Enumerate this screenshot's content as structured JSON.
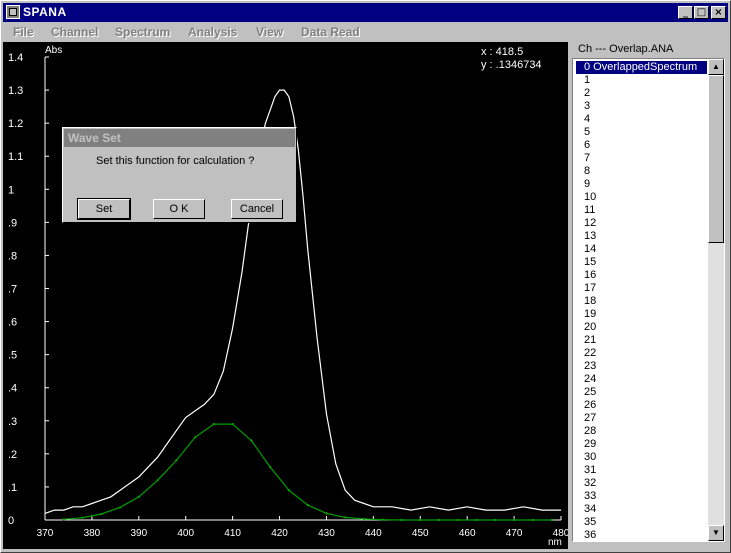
{
  "app": {
    "title": "SPANA"
  },
  "window_controls": {
    "minimize": "_",
    "maximize": "□",
    "close": "×"
  },
  "menu": [
    "File",
    "Channel",
    "Spectrum",
    "Analysis",
    "View",
    "Data Read"
  ],
  "cursor": {
    "x_readout": "x : 418.5",
    "y_readout": "y : .1346734"
  },
  "channel_list": {
    "title": "Ch --- Overlap.ANA",
    "items": [
      "0 OverlappedSpectrum",
      "1",
      "2",
      "3",
      "4",
      "5",
      "6",
      "7",
      "8",
      "9",
      "10",
      "11",
      "12",
      "13",
      "14",
      "15",
      "16",
      "17",
      "18",
      "19",
      "20",
      "21",
      "22",
      "23",
      "24",
      "25",
      "26",
      "27",
      "28",
      "29",
      "30",
      "31",
      "32",
      "33",
      "34",
      "35",
      "36"
    ],
    "selected_index": 0
  },
  "dialog": {
    "title": "Wave Set",
    "message": "Set this function for calculation ?",
    "buttons": [
      "Set",
      "O K",
      "Cancel"
    ]
  },
  "chart_data": {
    "type": "line",
    "ylabel": "Abs",
    "xlabel": "nm",
    "xlim": [
      370,
      480
    ],
    "ylim": [
      0,
      1.4
    ],
    "x_ticks": [
      "370",
      "380",
      "390",
      "400",
      "410",
      "420",
      "430",
      "440",
      "450",
      "460",
      "470",
      "480"
    ],
    "y_ticks": [
      "0",
      ".1",
      ".2",
      ".3",
      ".4",
      ".5",
      ".6",
      ".7",
      ".8",
      ".9",
      "1",
      "1.1",
      "1.2",
      "1.3",
      "1.4"
    ],
    "series": [
      {
        "color": "#ffffff",
        "x": [
          370,
          372,
          374,
          376,
          378,
          380,
          382,
          384,
          386,
          388,
          390,
          392,
          394,
          396,
          398,
          400,
          402,
          404,
          406,
          408,
          410,
          412,
          414,
          416,
          417,
          418,
          419,
          420,
          421,
          422,
          423,
          424,
          425,
          426,
          428,
          430,
          432,
          434,
          436,
          438,
          440,
          444,
          448,
          452,
          456,
          460,
          464,
          468,
          472,
          476,
          480
        ],
        "y": [
          0.02,
          0.03,
          0.03,
          0.04,
          0.04,
          0.05,
          0.06,
          0.07,
          0.09,
          0.11,
          0.13,
          0.16,
          0.19,
          0.23,
          0.27,
          0.31,
          0.33,
          0.35,
          0.38,
          0.45,
          0.58,
          0.75,
          0.96,
          1.14,
          1.2,
          1.24,
          1.28,
          1.3,
          1.3,
          1.28,
          1.22,
          1.12,
          0.98,
          0.82,
          0.55,
          0.32,
          0.17,
          0.09,
          0.06,
          0.05,
          0.04,
          0.04,
          0.03,
          0.04,
          0.03,
          0.04,
          0.03,
          0.03,
          0.04,
          0.03,
          0.03
        ]
      },
      {
        "color": "#00a000",
        "x": [
          374,
          378,
          382,
          386,
          390,
          394,
          398,
          402,
          406,
          410,
          414,
          418,
          422,
          426,
          430,
          434,
          438,
          442,
          446,
          450,
          454,
          458,
          462,
          466,
          470,
          474,
          478
        ],
        "y": [
          0.002,
          0.007,
          0.018,
          0.038,
          0.07,
          0.12,
          0.18,
          0.25,
          0.29,
          0.29,
          0.24,
          0.16,
          0.09,
          0.045,
          0.02,
          0.008,
          0.003,
          0.001,
          0,
          0,
          0,
          0,
          0,
          0,
          0,
          0,
          0
        ]
      }
    ]
  }
}
